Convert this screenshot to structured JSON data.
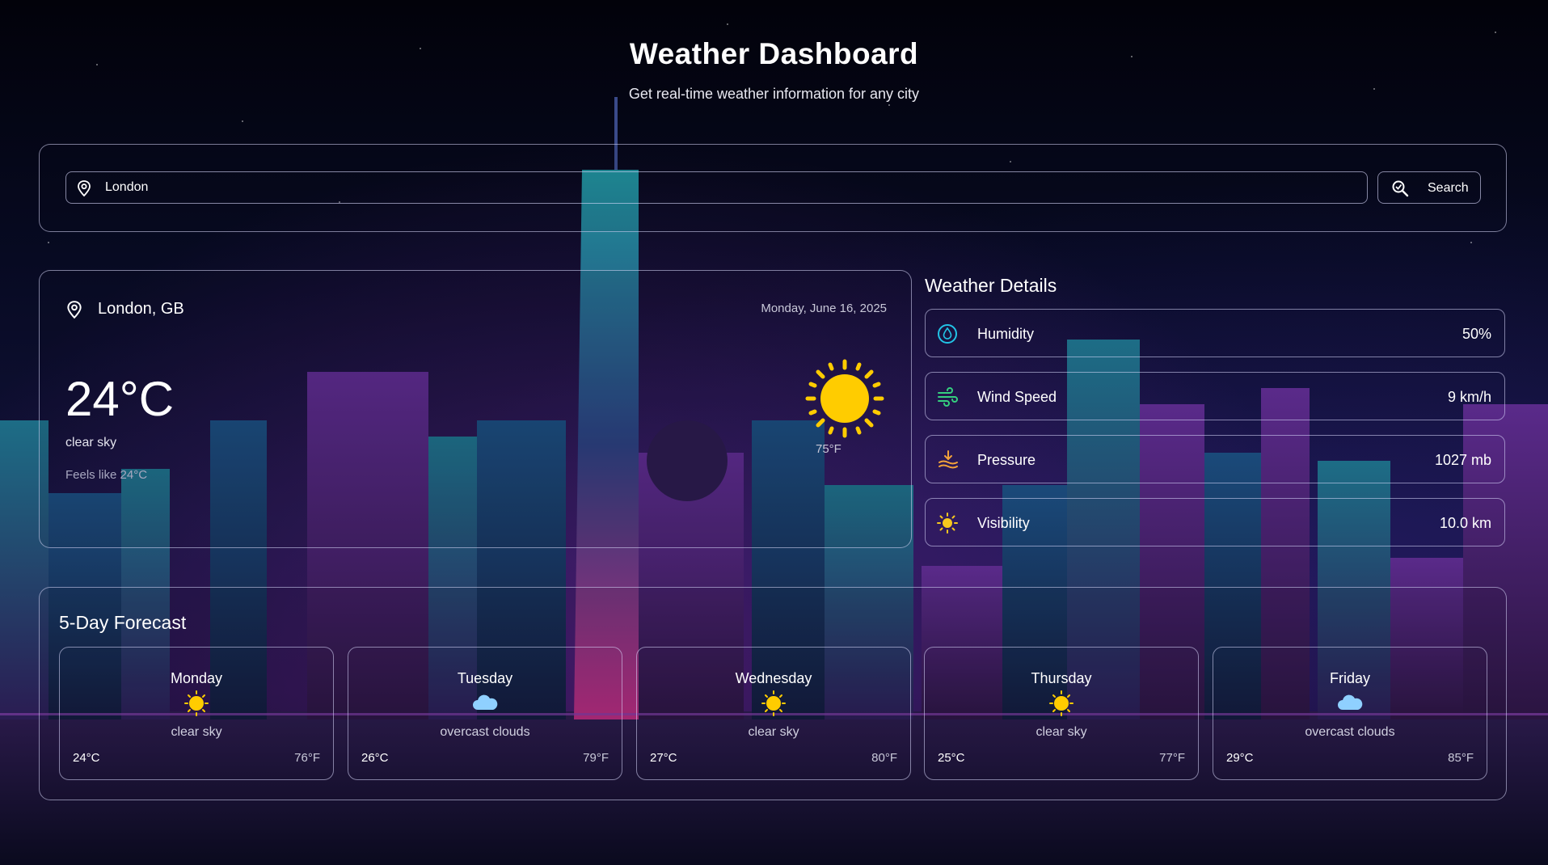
{
  "header": {
    "title": "Weather Dashboard",
    "subtitle": "Get real-time weather information for any city"
  },
  "search": {
    "value": "London",
    "button_label": "Search"
  },
  "current": {
    "location": "London, GB",
    "date": "Monday, June 16, 2025",
    "temp_c": "24°C",
    "description": "clear sky",
    "feels_like": "Feels like 24°C",
    "temp_f": "75°F",
    "icon": "sun-icon"
  },
  "details": {
    "title": "Weather Details",
    "items": [
      {
        "label": "Humidity",
        "value": "50%",
        "icon": "humidity-icon",
        "color": "#22c3e6"
      },
      {
        "label": "Wind Speed",
        "value": "9 km/h",
        "icon": "wind-icon",
        "color": "#35d07f"
      },
      {
        "label": "Pressure",
        "value": "1027 mb",
        "icon": "pressure-icon",
        "color": "#f2a23a"
      },
      {
        "label": "Visibility",
        "value": "10.0 km",
        "icon": "visibility-icon",
        "color": "#f7c81e"
      }
    ]
  },
  "forecast": {
    "title": "5-Day Forecast",
    "days": [
      {
        "day": "Monday",
        "desc": "clear sky",
        "c": "24°C",
        "f": "76°F",
        "icon": "sun-icon"
      },
      {
        "day": "Tuesday",
        "desc": "overcast clouds",
        "c": "26°C",
        "f": "79°F",
        "icon": "cloud-icon"
      },
      {
        "day": "Wednesday",
        "desc": "clear sky",
        "c": "27°C",
        "f": "80°F",
        "icon": "sun-icon"
      },
      {
        "day": "Thursday",
        "desc": "clear sky",
        "c": "25°C",
        "f": "77°F",
        "icon": "sun-icon"
      },
      {
        "day": "Friday",
        "desc": "overcast clouds",
        "c": "29°C",
        "f": "85°F",
        "icon": "cloud-icon"
      }
    ]
  },
  "colors": {
    "sun": "#ffcc00",
    "cloud": "#8fd0ff",
    "border": "#dcdcff"
  }
}
